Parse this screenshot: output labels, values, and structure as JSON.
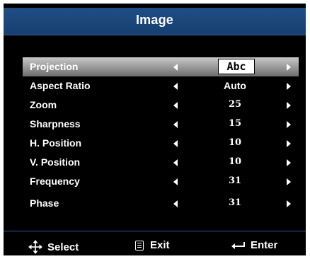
{
  "window": {
    "title": "Image"
  },
  "menu": {
    "items": [
      {
        "label": "Projection",
        "value": "Abc",
        "selected": true
      },
      {
        "label": "Aspect Ratio",
        "value": "Auto"
      },
      {
        "label": "Zoom",
        "value": "25"
      },
      {
        "label": "Sharpness",
        "value": "15"
      },
      {
        "label": "H. Position",
        "value": "10"
      },
      {
        "label": "V. Position",
        "value": "10"
      },
      {
        "label": "Frequency",
        "value": "31"
      },
      {
        "label": "Phase",
        "value": "31"
      }
    ]
  },
  "footer": {
    "select_label": "Select",
    "exit_label": "Exit",
    "enter_label": "Enter",
    "icons": [
      "four-way-arrow-icon",
      "menu-icon",
      "enter-return-icon"
    ]
  },
  "colors": {
    "title_bar": "#1f4e86",
    "background": "#000000",
    "selected_row": "#a0a0a0",
    "text": "#ffffff"
  }
}
